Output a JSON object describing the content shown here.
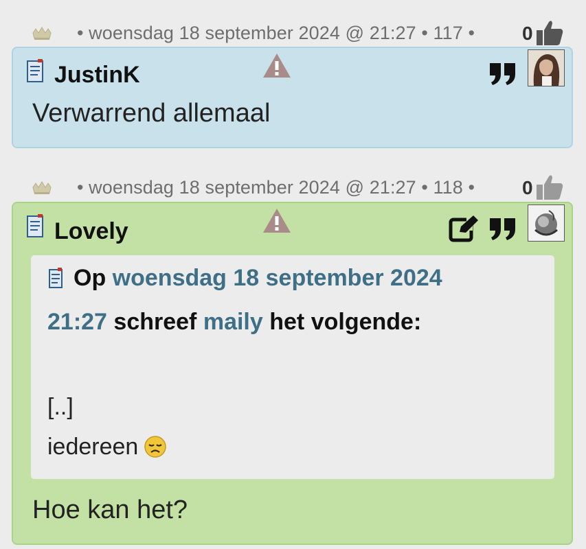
{
  "posts": [
    {
      "date": "• woensdag 18 september 2024 @ 21:27 • 117 •",
      "score": "0",
      "author": "JustinK",
      "body": "Verwarrend allemaal",
      "has_edit": false
    },
    {
      "date": "• woensdag 18 september 2024 @ 21:27 • 118 •",
      "score": "0",
      "author": "Lovely",
      "has_edit": true,
      "quote": {
        "prefix": "Op",
        "link_date_1": "woensdag 18 september 2024",
        "link_date_2": "21:27",
        "wrote": "schreef",
        "quoted_user": "maily",
        "suffix": "het volgende:",
        "line1": "[..]",
        "line2": "iedereen"
      },
      "body": "Hoe kan het?"
    }
  ],
  "icons": {
    "stars": "stars-icon",
    "thumb": "thumbs-up-icon",
    "note": "note-icon",
    "warning": "warning-icon",
    "quote": "quote-icon",
    "edit": "edit-icon",
    "emoji": "disappointed-emoji-icon"
  },
  "colors": {
    "post1_bg": "#c9e1ea",
    "post2_bg": "#c3e1a4",
    "link": "#3e6f86",
    "meta_text": "#6e6e6e"
  }
}
